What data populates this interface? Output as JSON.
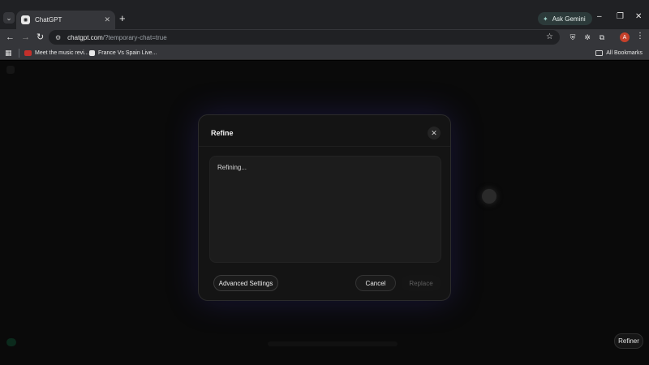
{
  "browser": {
    "tab": {
      "title": "ChatGPT"
    },
    "ask_gemini_label": "Ask Gemini",
    "url": {
      "host": "chatgpt.com",
      "path": "/?temporary-chat=true"
    },
    "bookmarks": [
      {
        "label": "Meet the music revi..."
      },
      {
        "label": "France Vs Spain Live..."
      }
    ],
    "all_bookmarks_label": "All Bookmarks",
    "profile_initial": "A",
    "colors": {
      "tabstrip": "#202124",
      "toolbar": "#35363a",
      "profile": "#c5402a"
    }
  },
  "page": {
    "refiner_label": "Refiner"
  },
  "modal": {
    "title": "Refine",
    "status_text": "Refining...",
    "advanced_label": "Advanced Settings",
    "cancel_label": "Cancel",
    "replace_label": "Replace",
    "colors": {
      "glow": "#463cc8"
    }
  }
}
